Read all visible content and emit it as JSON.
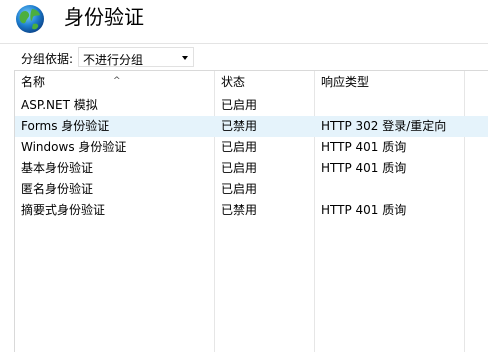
{
  "header": {
    "title": "身份验证",
    "icon": "globe-icon"
  },
  "toolbar": {
    "group_label": "分组依据:",
    "group_value": "不进行分组"
  },
  "table": {
    "columns": [
      "名称",
      "状态",
      "响应类型"
    ],
    "rows": [
      {
        "name": "ASP.NET 模拟",
        "status": "已启用",
        "response": ""
      },
      {
        "name": "Forms 身份验证",
        "status": "已禁用",
        "response": "HTTP 302 登录/重定向"
      },
      {
        "name": "Windows 身份验证",
        "status": "已启用",
        "response": "HTTP 401 质询"
      },
      {
        "name": "基本身份验证",
        "status": "已启用",
        "response": "HTTP 401 质询"
      },
      {
        "name": "匿名身份验证",
        "status": "已启用",
        "response": ""
      },
      {
        "name": "摘要式身份验证",
        "status": "已禁用",
        "response": "HTTP 401 质询"
      }
    ],
    "selected_row": 1
  },
  "colors": {
    "selected_row_bg": "#e5f3fb",
    "grid_line": "#e6e6e6"
  }
}
